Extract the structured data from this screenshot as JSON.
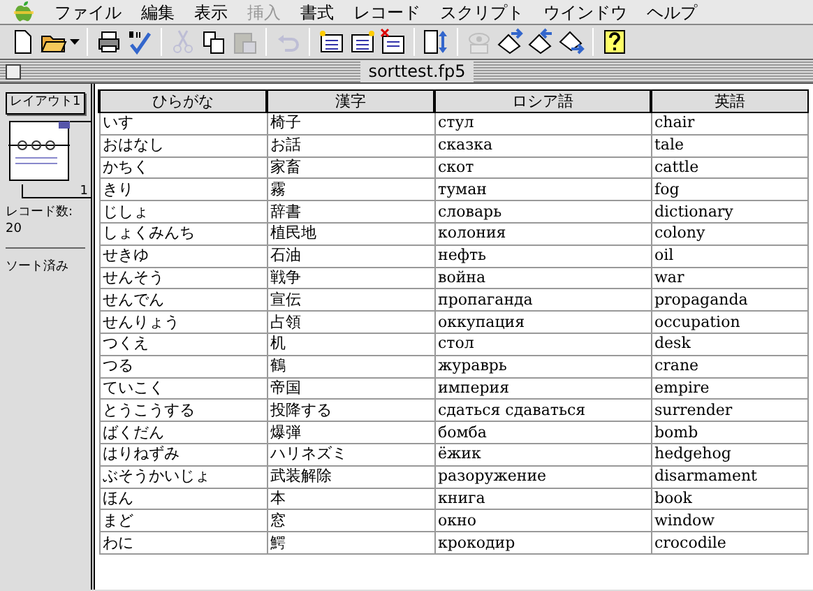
{
  "menu_bar": [
    {
      "label": "ファイル",
      "disabled": false
    },
    {
      "label": "編集",
      "disabled": false
    },
    {
      "label": "表示",
      "disabled": false
    },
    {
      "label": "挿入",
      "disabled": true
    },
    {
      "label": "書式",
      "disabled": false
    },
    {
      "label": "レコード",
      "disabled": false
    },
    {
      "label": "スクリプト",
      "disabled": false
    },
    {
      "label": "ウインドウ",
      "disabled": false
    },
    {
      "label": "ヘルプ",
      "disabled": false
    }
  ],
  "toolbar": [
    {
      "kind": "new",
      "disabled": false
    },
    {
      "kind": "open",
      "disabled": false
    },
    {
      "kind": "sep"
    },
    {
      "kind": "print",
      "disabled": false
    },
    {
      "kind": "spell",
      "disabled": false
    },
    {
      "kind": "sep"
    },
    {
      "kind": "cut",
      "disabled": true
    },
    {
      "kind": "copy",
      "disabled": false
    },
    {
      "kind": "paste",
      "disabled": true
    },
    {
      "kind": "sep"
    },
    {
      "kind": "undo",
      "disabled": true
    },
    {
      "kind": "sep"
    },
    {
      "kind": "newrec",
      "disabled": false
    },
    {
      "kind": "duprec",
      "disabled": false
    },
    {
      "kind": "delrec",
      "disabled": false
    },
    {
      "kind": "sep"
    },
    {
      "kind": "sort",
      "disabled": false
    },
    {
      "kind": "sep"
    },
    {
      "kind": "browse",
      "disabled": true
    },
    {
      "kind": "import",
      "disabled": false
    },
    {
      "kind": "export",
      "disabled": false
    },
    {
      "kind": "send",
      "disabled": false
    },
    {
      "kind": "sep"
    },
    {
      "kind": "help",
      "disabled": false
    }
  ],
  "window": {
    "title": "sorttest.fp5"
  },
  "status_area": {
    "layout": "レイアウト1",
    "page": "1",
    "record_count_label": "レコード数:",
    "record_count": "20",
    "sort_state": "ソート済み"
  },
  "table": {
    "columns": [
      "ひらがな",
      "漢字",
      "ロシア語",
      "英語"
    ],
    "rows": [
      [
        "いす",
        "椅子",
        "стул",
        "chair"
      ],
      [
        "おはなし",
        "お話",
        "сказка",
        "tale"
      ],
      [
        "かちく",
        "家畜",
        "скот",
        "cattle"
      ],
      [
        "きり",
        "霧",
        "туман",
        "fog"
      ],
      [
        "じしょ",
        "辞書",
        "словарь",
        "dictionary"
      ],
      [
        "しょくみんち",
        "植民地",
        "колония",
        "colony"
      ],
      [
        "せきゆ",
        "石油",
        "нефть",
        "oil"
      ],
      [
        "せんそう",
        "戦争",
        "война",
        "war"
      ],
      [
        "せんでん",
        "宣伝",
        "пропаганда",
        "propaganda"
      ],
      [
        "せんりょう",
        "占領",
        "оккупация",
        "occupation"
      ],
      [
        "つくえ",
        "机",
        "стол",
        "desk"
      ],
      [
        "つる",
        "鶴",
        "жураврь",
        "crane"
      ],
      [
        "ていこく",
        "帝国",
        "империя",
        "empire"
      ],
      [
        "とうこうする",
        "投降する",
        "сдаться сдаваться",
        "surrender"
      ],
      [
        "ばくだん",
        "爆弾",
        "бомба",
        "bomb"
      ],
      [
        "はりねずみ",
        "ハリネズミ",
        "ёжик",
        "hedgehog"
      ],
      [
        "ぶそうかいじょ",
        "武装解除",
        "разоружение",
        "disarmament"
      ],
      [
        "ほん",
        "本",
        "книга",
        "book"
      ],
      [
        "まど",
        "窓",
        "окно",
        "window"
      ],
      [
        "わに",
        "鰐",
        "крокодир",
        "crocodile"
      ]
    ]
  }
}
